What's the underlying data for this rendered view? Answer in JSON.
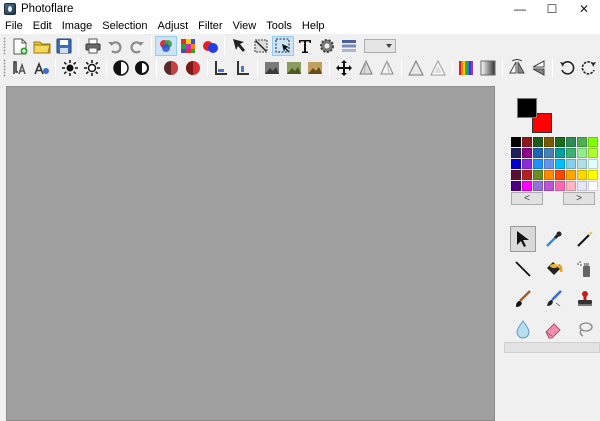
{
  "window": {
    "title": "Photoflare",
    "minimize": "—",
    "maximize": "☐",
    "close": "✕"
  },
  "menu": [
    "File",
    "Edit",
    "Image",
    "Selection",
    "Adjust",
    "Filter",
    "View",
    "Tools",
    "Help"
  ],
  "toolbar1": [
    "new-document",
    "open-folder",
    "save",
    "print",
    "undo",
    "redo",
    "color-filter",
    "mosaic",
    "balls",
    "selection-arrow",
    "crop",
    "selection-box",
    "text",
    "settings",
    "layers",
    "zoom-combo"
  ],
  "toolbar2": [
    "text-sharpen",
    "text-effect",
    "brightness-up",
    "brightness-down",
    "contrast",
    "invert",
    "sphere-dark",
    "sphere-red",
    "align-left",
    "align-bottom",
    "landscape-dark",
    "landscape-green",
    "landscape-light",
    "move",
    "cone",
    "cone-outline",
    "triangle",
    "triangle-outline",
    "rainbow",
    "gradient",
    "flip-horizontal",
    "flip-vertical",
    "rotate-left",
    "rotate-right"
  ],
  "colors": {
    "foreground": "#000000",
    "background": "#ff0000"
  },
  "palette": [
    "#000000",
    "#8b1a1a",
    "#1f5a1f",
    "#7a5c00",
    "#1a6b1a",
    "#2e8b57",
    "#4caf50",
    "#7fff00",
    "#202060",
    "#8b008b",
    "#1e64b4",
    "#4682b4",
    "#00a0a0",
    "#3cb371",
    "#90ee90",
    "#adff2f",
    "#0000cd",
    "#8a2be2",
    "#1e90ff",
    "#6495ed",
    "#00bfff",
    "#87ceeb",
    "#b0e0e6",
    "#e0ffff",
    "#5a1030",
    "#b22222",
    "#6b8e23",
    "#ff8c00",
    "#ff4500",
    "#ffa500",
    "#ffd700",
    "#ffff00",
    "#4b0082",
    "#ff00ff",
    "#9370db",
    "#ba55d3",
    "#ff69b4",
    "#ffb6c1",
    "#e6e6fa",
    "#ffffff"
  ],
  "palette_nav": {
    "prev": "<",
    "next": ">"
  },
  "tools": [
    "pointer",
    "color-picker",
    "magic-wand",
    "line",
    "paint-bucket",
    "spray-can",
    "paint-brush",
    "smudge-brush",
    "stamp",
    "blur-drop",
    "eraser",
    "lasso"
  ]
}
